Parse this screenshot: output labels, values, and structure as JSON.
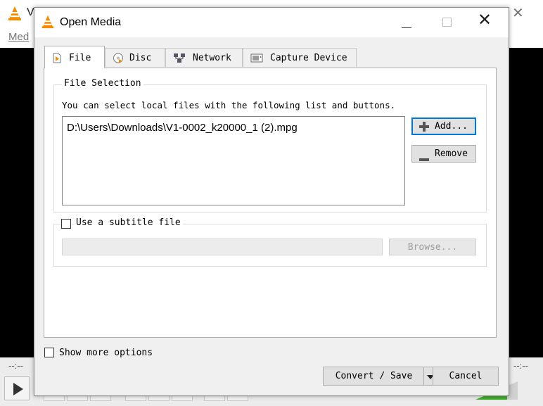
{
  "background_app": {
    "title_visible": "V",
    "menu_media": "Med",
    "time_left": "--:--",
    "time_right": "--:--"
  },
  "dialog": {
    "title": "Open Media",
    "tabs": [
      {
        "label": "File",
        "icon": "file-icon",
        "active": true
      },
      {
        "label": "Disc",
        "icon": "disc-icon",
        "active": false
      },
      {
        "label": "Network",
        "icon": "network-icon",
        "active": false
      },
      {
        "label": "Capture Device",
        "icon": "capture-device-icon",
        "active": false
      }
    ],
    "file_selection": {
      "group_title": "File Selection",
      "hint": "You can select local files with the following list and buttons.",
      "files": [
        "D:\\Users\\Downloads\\V1-0002_k20000_1 (2).mpg"
      ],
      "add_label": "Add...",
      "remove_label": "Remove"
    },
    "subtitle": {
      "checkbox_label": "Use a subtitle file",
      "checked": false,
      "path_value": "",
      "browse_label": "Browse..."
    },
    "show_more_label": "Show more options",
    "show_more_checked": false,
    "convert_save_label": "Convert / Save",
    "cancel_label": "Cancel"
  },
  "colors": {
    "vlc_orange": "#f48b00",
    "dialog_bg": "#f0f0f0",
    "video_bg": "#000000",
    "focus_blue": "#0078d7"
  }
}
